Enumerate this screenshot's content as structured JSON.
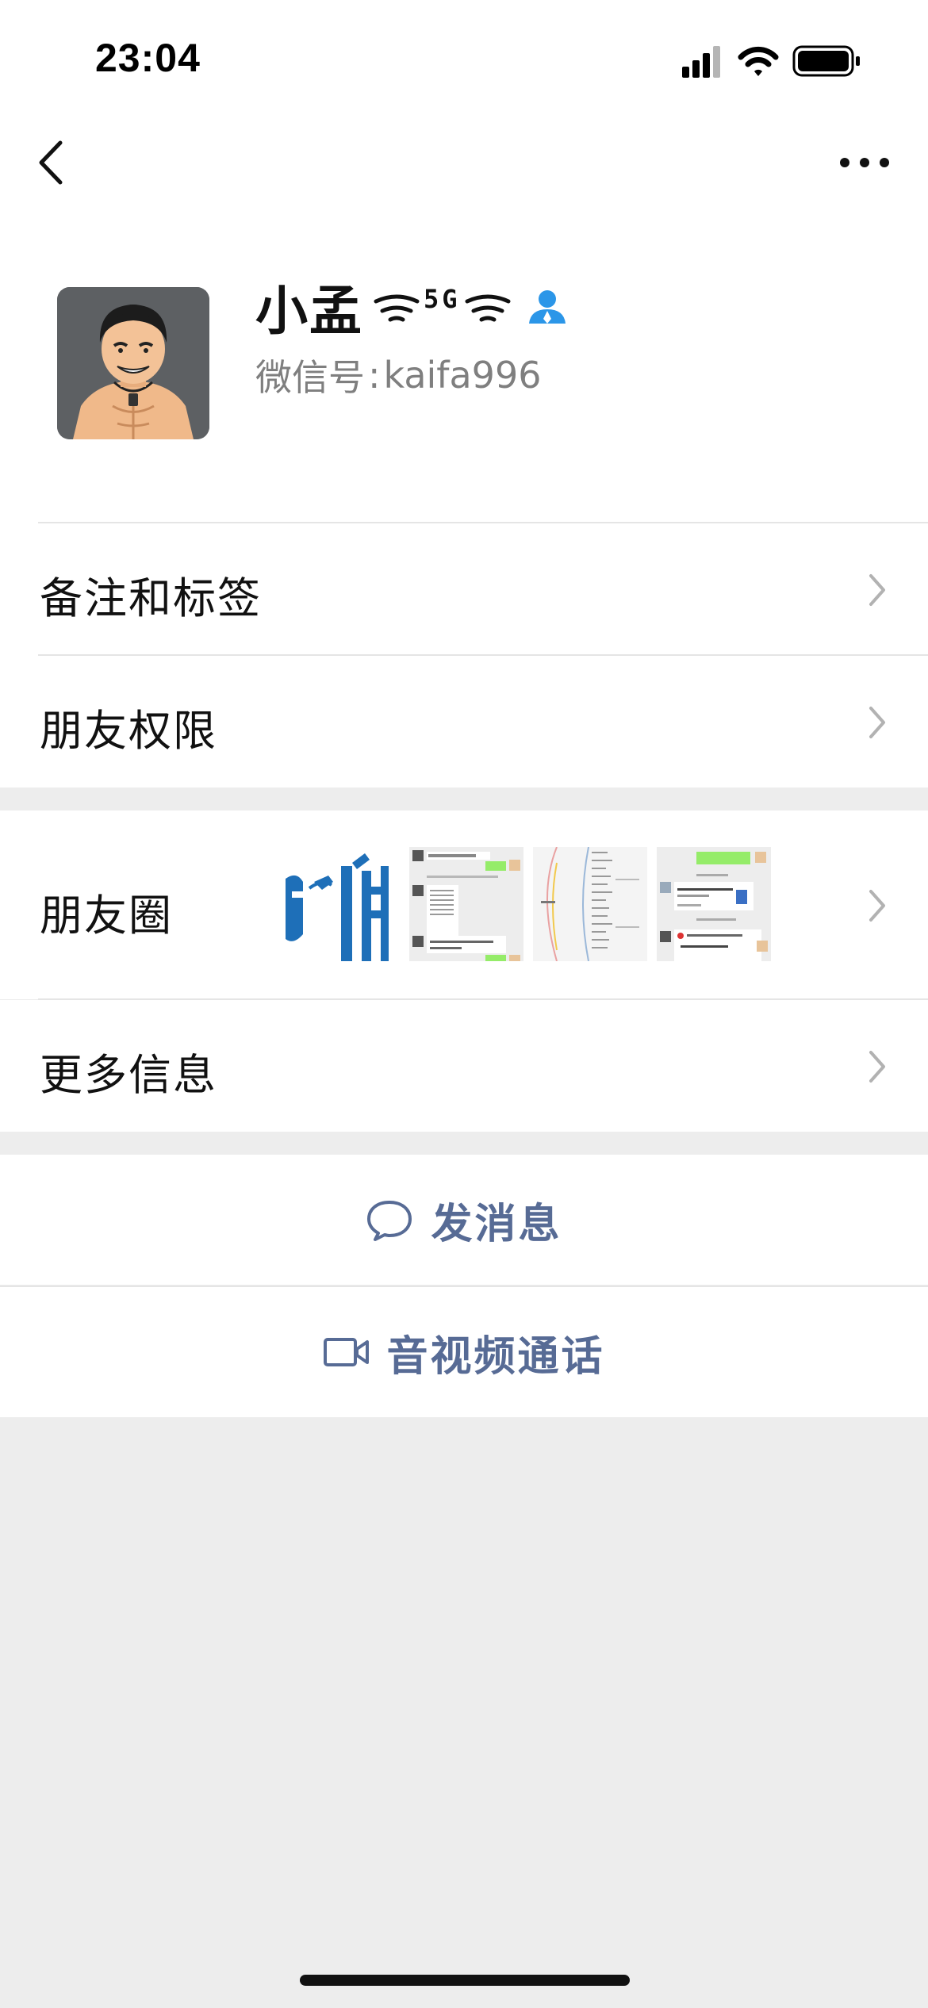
{
  "status_bar": {
    "time": "23:04",
    "icons": [
      "signal-icon",
      "wifi-icon",
      "battery-icon"
    ]
  },
  "nav": {
    "back_icon": "chevron-left-icon",
    "more_icon": "more-dots-icon"
  },
  "profile": {
    "name": "小孟",
    "name_decoration": "5G",
    "wechat_id_label": "微信号",
    "wechat_id_colon": ":",
    "wechat_id": "kaifa996",
    "contact_icon": "contact-person-icon"
  },
  "rows": {
    "remarks_tags": "备注和标签",
    "friend_permissions": "朋友权限",
    "moments": "朋友圈",
    "more_info": "更多信息"
  },
  "actions": {
    "send_message": "发消息",
    "av_call": "音视频通话"
  },
  "colors": {
    "link_blue": "#576b95",
    "accent_icon_blue": "#2b96e8",
    "page_bg": "#ededed"
  }
}
